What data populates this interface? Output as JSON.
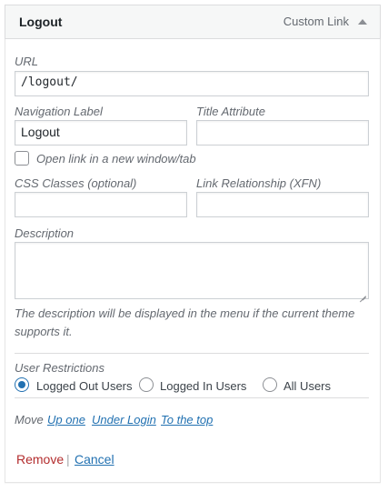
{
  "item": {
    "title": "Logout",
    "type": "Custom Link"
  },
  "url": {
    "label": "URL",
    "value": "/logout/"
  },
  "nav_label": {
    "label": "Navigation Label",
    "value": "Logout"
  },
  "title_attr": {
    "label": "Title Attribute",
    "value": ""
  },
  "new_window": {
    "label": "Open link in a new window/tab",
    "checked": false
  },
  "css_classes": {
    "label": "CSS Classes (optional)",
    "value": ""
  },
  "xfn": {
    "label": "Link Relationship (XFN)",
    "value": ""
  },
  "description": {
    "label": "Description",
    "value": "",
    "help_line1": "The description will be displayed in the menu if the current theme",
    "help_line2": "supports it."
  },
  "restrictions": {
    "label": "User Restrictions",
    "options": [
      "Logged Out Users",
      "Logged In Users",
      "All Users"
    ],
    "selected": "Logged Out Users"
  },
  "move": {
    "label": "Move",
    "links": [
      "Up one",
      "Under Login",
      "To the top"
    ]
  },
  "actions": {
    "remove": "Remove",
    "separator": "|",
    "cancel": "Cancel"
  },
  "colors": {
    "link": "#2271b1",
    "remove": "#b32d2e",
    "radio_selected": "#2271b1"
  }
}
